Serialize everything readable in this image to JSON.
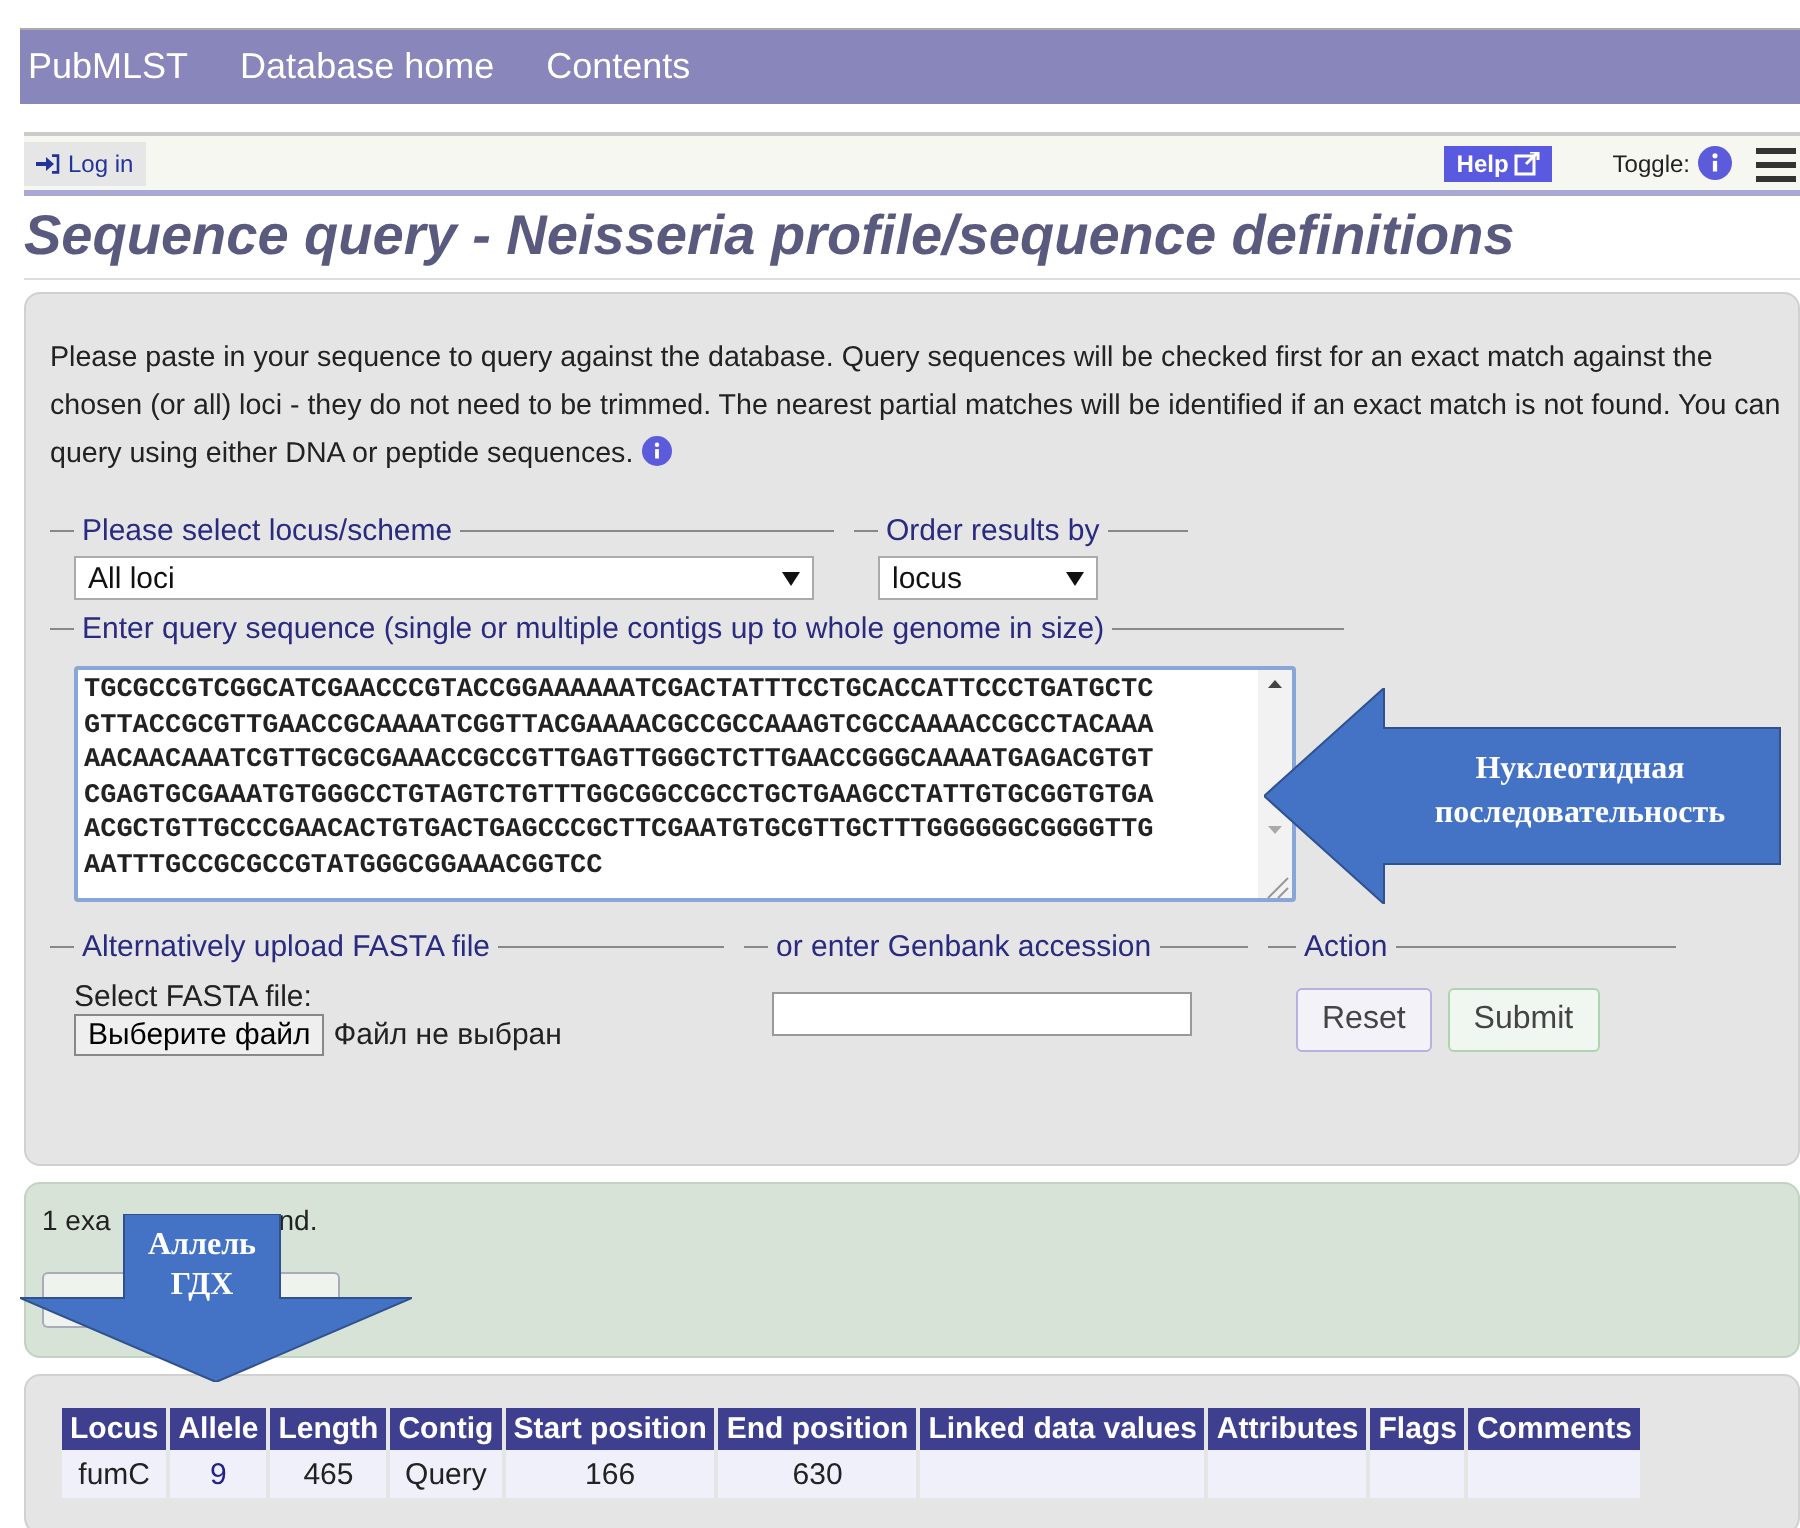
{
  "nav": {
    "links": [
      "PubMLST",
      "Database home",
      "Contents"
    ]
  },
  "toolbar": {
    "login": "Log in",
    "help": "Help",
    "toggle_label": "Toggle:"
  },
  "title": "Sequence query - Neisseria profile/sequence definitions",
  "query_form": {
    "intro": "Please paste in your sequence to query against the database. Query sequences will be checked first for an exact match against the chosen (or all) loci - they do not need to be trimmed. The nearest partial matches will be identified if an exact match is not found. You can query using either DNA or peptide sequences.",
    "locus_legend": "Please select locus/scheme",
    "locus_value": "All loci",
    "order_legend": "Order results by",
    "order_value": "locus",
    "sequence_legend": "Enter query sequence (single or multiple contigs up to whole genome in size)",
    "sequence_lines": [
      "TGCGCCGTCGGCATCGAACCCGTACCGGAAAAAATCGACTATTTCCTGCACCATTCCCTGATGCTC",
      "GTTACCGCGTTGAACCGCAAAATCGGTTACGAAAACGCCGCCAAAGTCGCCAAAACCGCCTACAAA",
      "AACAACAAATCGTTGCGCGAAACCGCCGTTGAGTTGGGCTCTTGAACCGGGCAAAATGAGACGTGT",
      "CGAGTGCGAAATGTGGGCCTGTAGTCTGTTTGGCGGCCGCCTGCTGAAGCCTATTGTGCGGTGTGA",
      "ACGCTGTTGCCCGAACACTGTGACTGAGCCCGCTTCGAATGTGCGTTGCTTTGGGGGGCGGGGTTG",
      "AATTTGCCGCGCCGTATGGGCGGAAACGGTCC"
    ],
    "upload_legend": "Alternatively upload FASTA file",
    "upload_label": "Select FASTA file:",
    "file_button": "Выберите файл",
    "file_status": "Файл не выбран",
    "genbank_legend": "or enter Genbank accession",
    "action_legend": "Action",
    "buttons": [
      "Reset",
      "Submit"
    ]
  },
  "result": {
    "message_parts": [
      "1 exa",
      "nd."
    ]
  },
  "table": {
    "columns": [
      "Locus",
      "Allele",
      "Length",
      "Contig",
      "Start position",
      "End position",
      "Linked data values",
      "Attributes",
      "Flags",
      "Comments"
    ],
    "rows": [
      [
        "fumC",
        "9",
        "465",
        "Query",
        "166",
        "630",
        "",
        "",
        "",
        ""
      ]
    ]
  },
  "annotations": [
    {
      "kind": "left-arrow",
      "text": "Нуклеотидная последовательность"
    },
    {
      "kind": "down-arrow",
      "text": "Аллель ГДХ"
    }
  ]
}
